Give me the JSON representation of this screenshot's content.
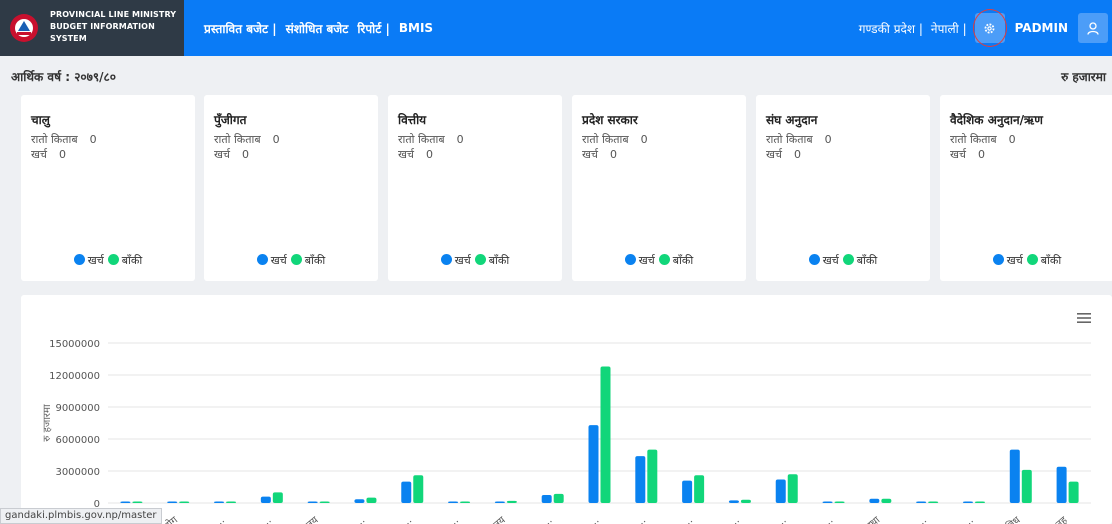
{
  "header": {
    "brand_text": "PROVINCIAL LINE MINISTRY BUDGET INFORMATION SYSTEM",
    "nav": [
      "प्रस्तावित बजेट |",
      "संशोधित बजेट",
      "रिपोर्ट |",
      "BMIS"
    ],
    "province": "गण्डकी प्रदेश |",
    "language": "नेपाली |",
    "user": "PADMIN",
    "accent": "#0a7bf6"
  },
  "fiscal": {
    "label": "आर्थिक वर्ष : २०७९/८०",
    "unit": "रु हजारमा"
  },
  "cards": [
    {
      "title": "चालु",
      "red_book_label": "रातो किताब",
      "red_book_value": "0",
      "expense_label": "खर्च",
      "expense_value": "0",
      "legend_spent": "खर्च",
      "legend_remaining": "बाँकी"
    },
    {
      "title": "पुँजीगत",
      "red_book_label": "रातो किताब",
      "red_book_value": "0",
      "expense_label": "खर्च",
      "expense_value": "0",
      "legend_spent": "खर्च",
      "legend_remaining": "बाँकी"
    },
    {
      "title": "वित्तीय",
      "red_book_label": "रातो किताब",
      "red_book_value": "0",
      "expense_label": "खर्च",
      "expense_value": "0",
      "legend_spent": "खर्च",
      "legend_remaining": "बाँकी"
    },
    {
      "title": "प्रदेश सरकार",
      "red_book_label": "रातो किताब",
      "red_book_value": "0",
      "expense_label": "खर्च",
      "expense_value": "0",
      "legend_spent": "खर्च",
      "legend_remaining": "बाँकी"
    },
    {
      "title": "संघ अनुदान",
      "red_book_label": "रातो किताब",
      "red_book_value": "0",
      "expense_label": "खर्च",
      "expense_value": "0",
      "legend_spent": "खर्च",
      "legend_remaining": "बाँकी"
    },
    {
      "title": "वैदेशिक अनुदान/ऋण",
      "red_book_label": "रातो किताब",
      "red_book_value": "0",
      "expense_label": "खर्च",
      "expense_value": "0",
      "legend_spent": "खर्च",
      "legend_remaining": "बाँकी"
    }
  ],
  "colors": {
    "spent": "#0a82f0",
    "remaining": "#11d67a"
  },
  "status_url": "gandaki.plmbis.gov.np/master",
  "chart_data": {
    "type": "bar",
    "ylabel": "रु हजारमा",
    "ylim": [
      0,
      15000000
    ],
    "yticks": [
      "0",
      "3000000",
      "6000000",
      "9000000",
      "12000000",
      "15000000"
    ],
    "categories": [
      "…",
      "…योग",
      "…",
      "…",
      "…लय",
      "…",
      "…",
      "…",
      "…लय",
      "…",
      "…",
      "…",
      "…",
      "…",
      "…",
      "…",
      "…स्था",
      "…",
      "…",
      "…विध",
      "…तह"
    ],
    "series": [
      {
        "values": [
          100000,
          100000,
          50000,
          600000,
          100000,
          350000,
          2000000,
          100000,
          100000,
          750000,
          7300000,
          4400000,
          2100000,
          250000,
          2200000,
          50000,
          400000,
          50000,
          50000,
          5000000,
          3400000
        ]
      },
      {
        "values": [
          100000,
          100000,
          50000,
          1000000,
          100000,
          500000,
          2600000,
          100000,
          200000,
          850000,
          12800000,
          5000000,
          2600000,
          300000,
          2700000,
          50000,
          400000,
          50000,
          50000,
          3100000,
          2000000
        ]
      }
    ]
  }
}
